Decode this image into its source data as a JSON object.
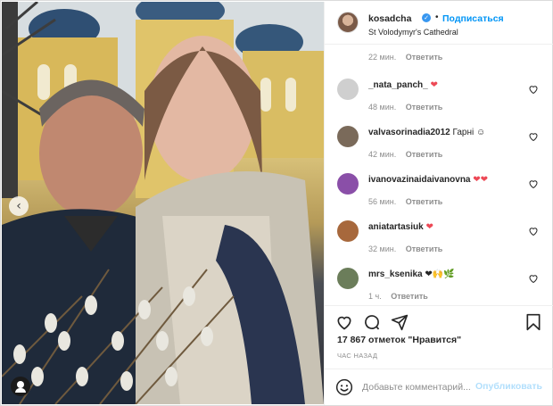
{
  "post": {
    "username": "kosadcha",
    "follow_label": "Подписаться",
    "separator": "•",
    "location": "St Volodymyr's Cathedral",
    "colors": {
      "accent": "#0095f6",
      "verified": "#3897f0",
      "like_red": "#ed4956",
      "muted": "#8e8e8e"
    }
  },
  "top_comment_meta": {
    "time": "22 мин.",
    "reply": "Ответить"
  },
  "comments": [
    {
      "username": "_nata_panch_",
      "text": "❤",
      "time": "48 мин.",
      "reply": "Ответить",
      "avatar_color": "#cfcfcf"
    },
    {
      "username": "valvasorinadia2012",
      "text": "Гарні ☺",
      "time": "42 мин.",
      "reply": "Ответить",
      "avatar_color": "#7a6a5a"
    },
    {
      "username": "ivanovazinaidaivanovna",
      "text": "❤❤",
      "time": "56 мин.",
      "reply": "Ответить",
      "avatar_color": "#8a4fa8"
    },
    {
      "username": "aniatartasiuk",
      "text": "❤",
      "time": "32 мин.",
      "reply": "Ответить",
      "avatar_color": "#a7683c"
    },
    {
      "username": "mrs_ksenika",
      "text": "❤🙌🌿",
      "time": "1 ч.",
      "reply": "Ответить",
      "avatar_color": "#6b7d5a"
    }
  ],
  "likes": "17 867 отметок \"Нравится\"",
  "posted_ago": "ЧАС НАЗАД",
  "add_comment": {
    "placeholder": "Добавьте комментарий...",
    "publish_label": "Опубликовать"
  },
  "icons": [
    "heart-icon",
    "comment-icon",
    "share-icon",
    "bookmark-icon",
    "emoji-icon",
    "verified-badge-icon",
    "tag-user-icon",
    "carousel-prev-icon"
  ]
}
